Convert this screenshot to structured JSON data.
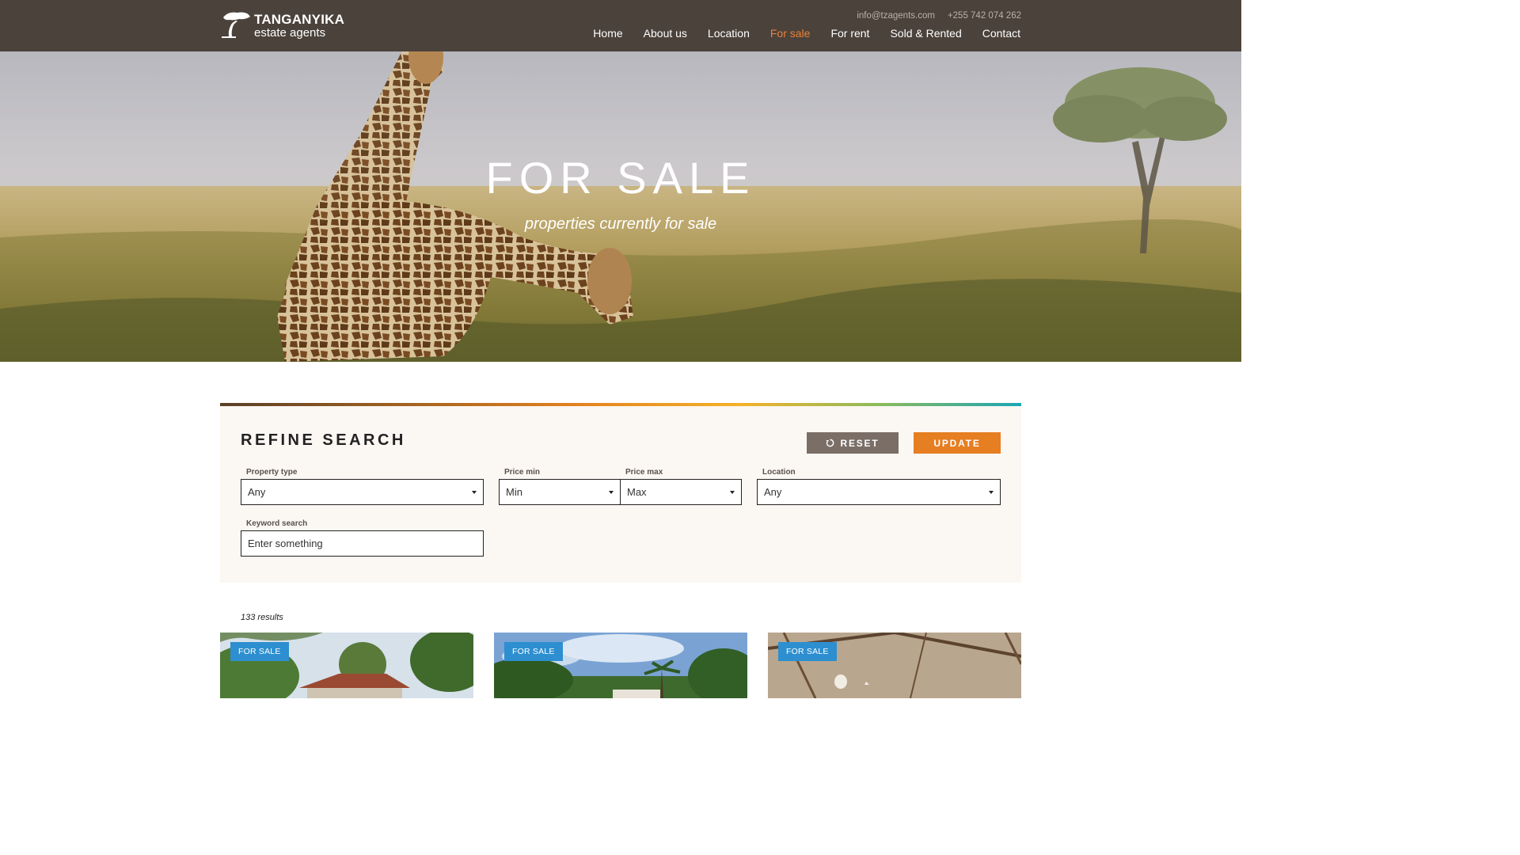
{
  "header": {
    "logo": {
      "title": "TANGANYIKA",
      "subtitle": "estate agents"
    },
    "email": "info@tzagents.com",
    "phone": "+255 742 074 262",
    "nav": [
      "Home",
      "About us",
      "Location",
      "For sale",
      "For rent",
      "Sold & Rented",
      "Contact"
    ],
    "active_nav": "For sale"
  },
  "hero": {
    "title": "FOR SALE",
    "subtitle": "properties currently for sale"
  },
  "search": {
    "title": "REFINE SEARCH",
    "reset_label": "RESET",
    "update_label": "UPDATE",
    "property_type": {
      "label": "Property type",
      "value": "Any"
    },
    "price_min": {
      "label": "Price min",
      "value": "Min"
    },
    "price_max": {
      "label": "Price max",
      "value": "Max"
    },
    "location": {
      "label": "Location",
      "value": "Any"
    },
    "keyword": {
      "label": "Keyword search",
      "placeholder": "Enter something"
    }
  },
  "results": {
    "count_text": "133 results",
    "cards": [
      {
        "badge": "FOR SALE"
      },
      {
        "badge": "FOR SALE"
      },
      {
        "badge": "FOR SALE"
      }
    ]
  },
  "colors": {
    "header_bg": "#4b423b",
    "accent": "#e67e22",
    "badge": "#2d8fd0",
    "reset_button": "#7a6e67"
  }
}
